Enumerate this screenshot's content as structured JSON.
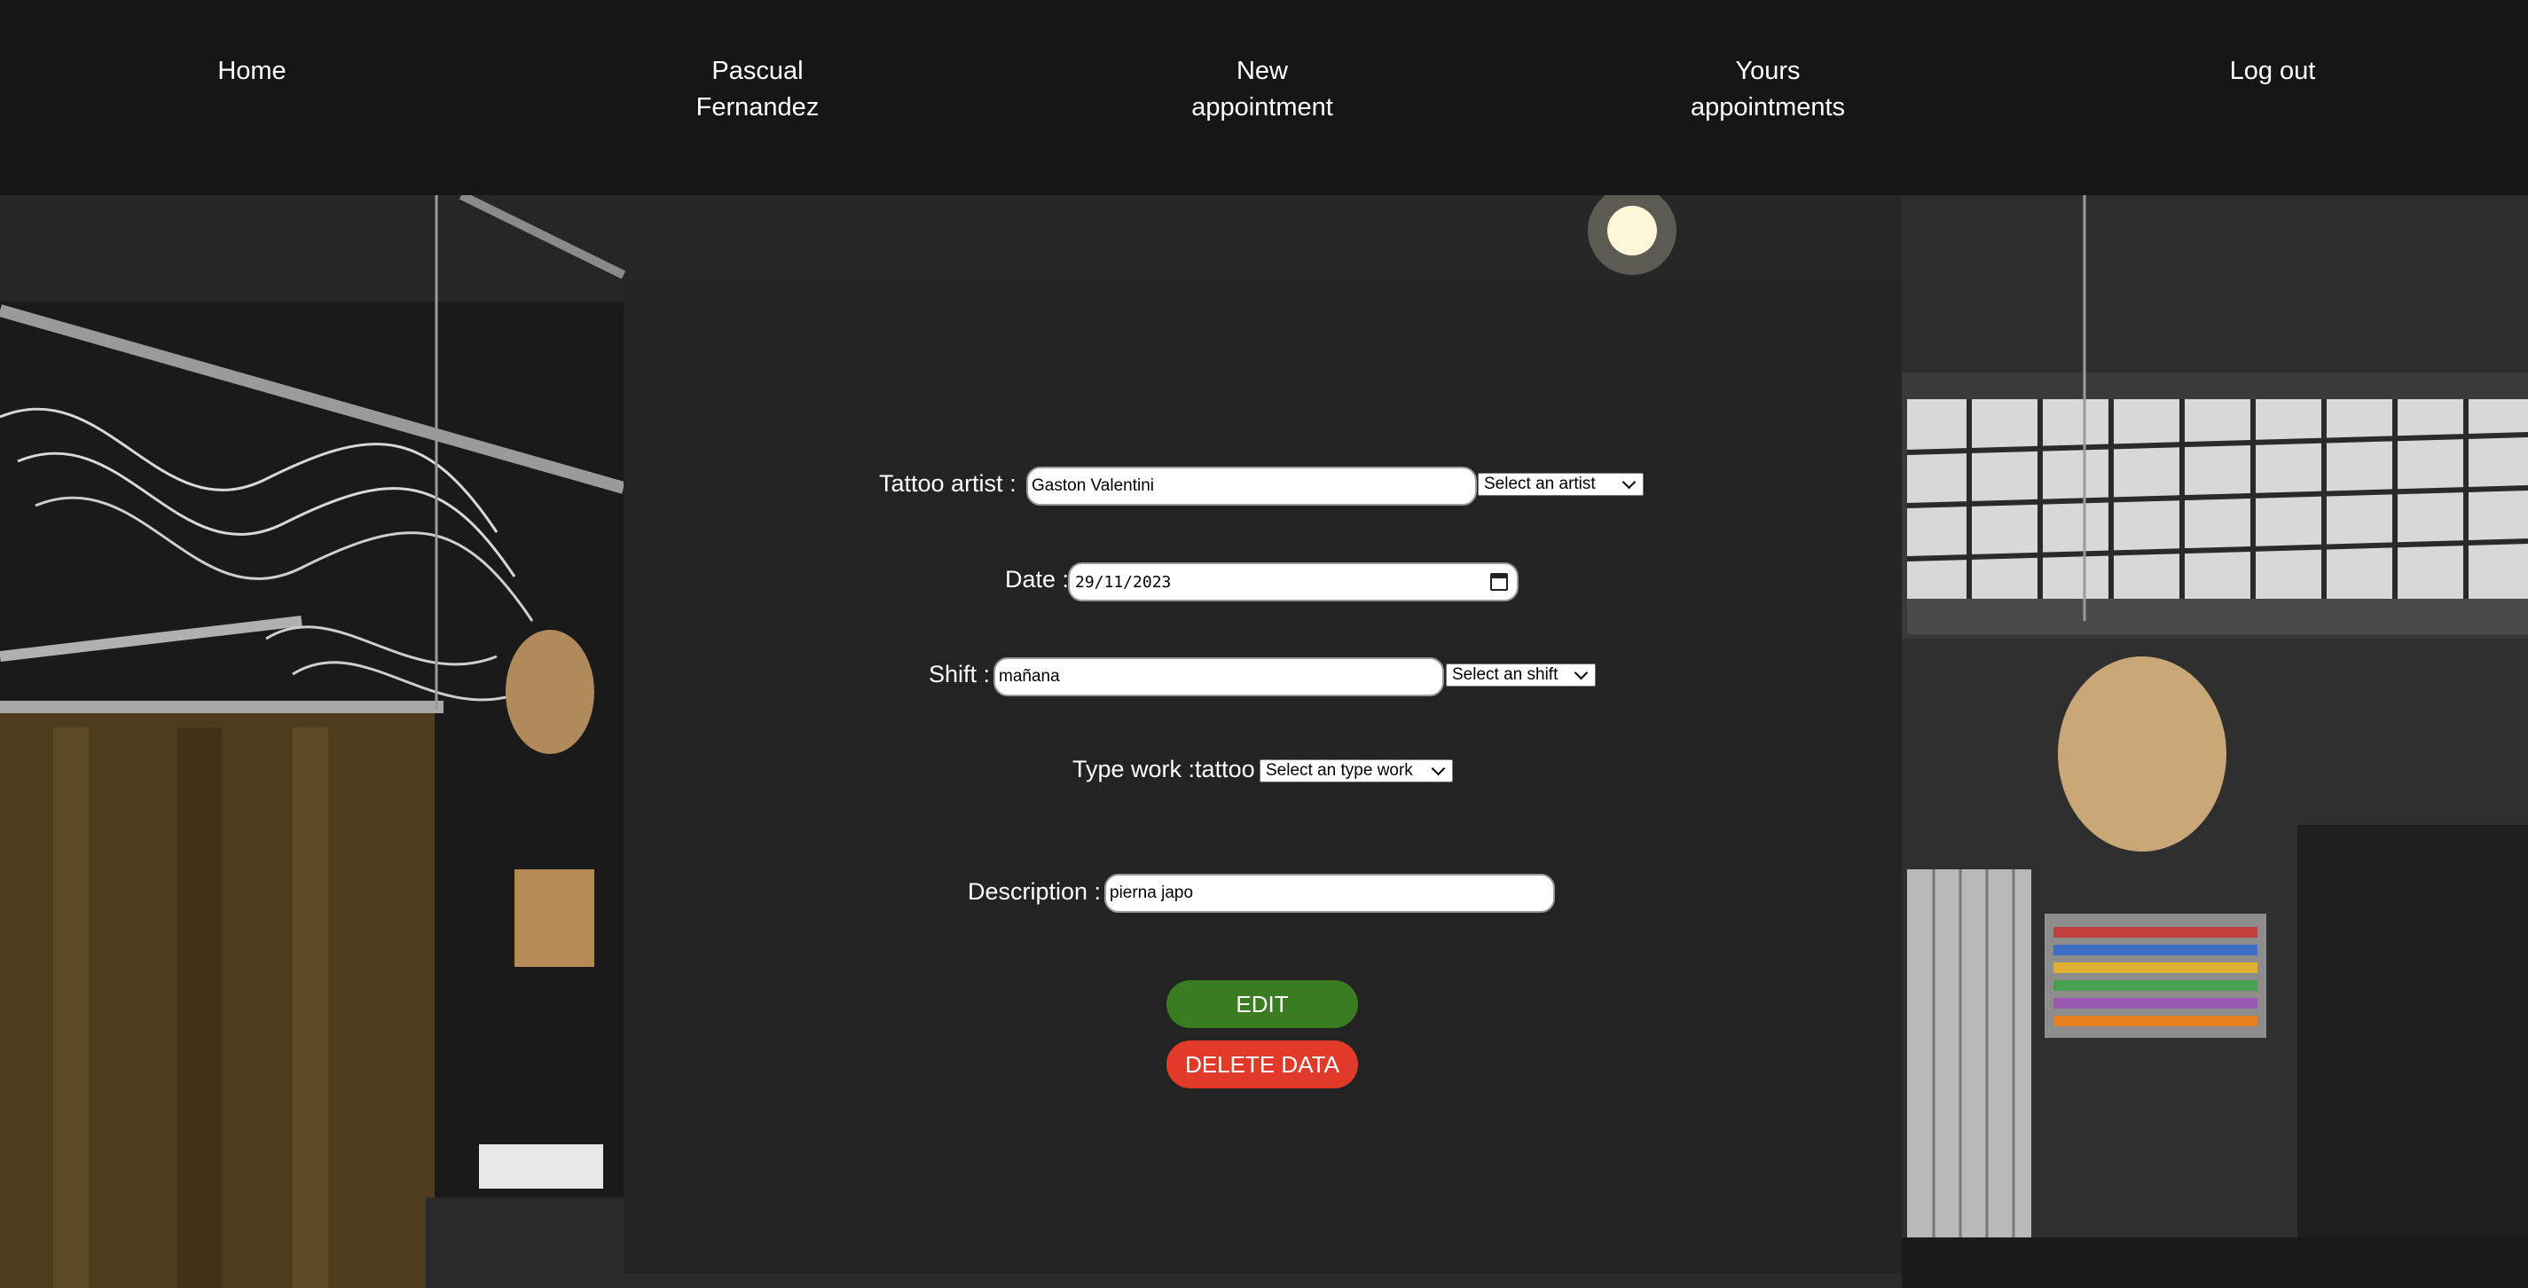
{
  "nav": {
    "home": "Home",
    "profile_line1": "Pascual",
    "profile_line2": "Fernandez",
    "new_line1": "New",
    "new_line2": "appointment",
    "yours_line1": "Yours",
    "yours_line2": "appointments",
    "logout": "Log out"
  },
  "form": {
    "artist_label": "Tattoo artist :",
    "artist_value": "Gaston Valentini",
    "artist_select": "Select an artist",
    "date_label": "Date :",
    "date_value": "29/11/2023",
    "shift_label": "Shift :",
    "shift_value": "mañana",
    "shift_select": "Select an shift",
    "type_label": "Type work :",
    "type_value": "tattoo",
    "type_select": "Select an type work",
    "description_label": "Description :",
    "description_value": "pierna japo"
  },
  "buttons": {
    "edit": "EDIT",
    "delete": "DELETE DATA"
  },
  "colors": {
    "edit": "#3a7c22",
    "delete": "#e23a2a",
    "navbar": "#161616",
    "panel": "#232323"
  }
}
